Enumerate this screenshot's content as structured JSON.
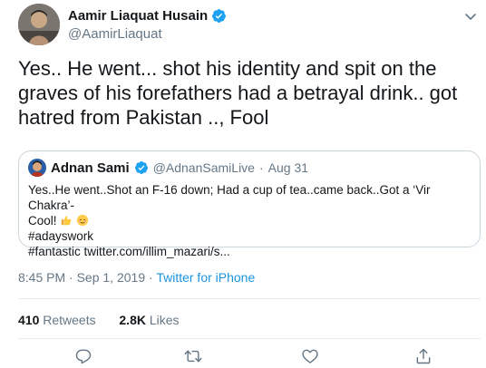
{
  "author": {
    "display_name": "Aamir Liaquat Husain",
    "handle": "@AamirLiaquat"
  },
  "tweet": {
    "text": "Yes.. He went... shot his identity and spit on the graves of his forefathers had a betrayal drink.. got hatred from Pakistan .., Fool"
  },
  "quoted_tweet": {
    "display_name": "Adnan Sami",
    "handle": "@AdnanSamiLive",
    "separator": "·",
    "date": "Aug 31",
    "line1": "Yes..He went..Shot an F-16 down; Had a cup of tea..came back..Got a ‘Vir Chakra’-",
    "line2": "Cool!",
    "hashtag": "#adayswork",
    "link_line": "#fantastic twitter.com/illim_mazari/s..."
  },
  "meta": {
    "time": "8:45 PM",
    "sep": "·",
    "date": "Sep 1, 2019",
    "sep2": "·",
    "source": "Twitter for iPhone"
  },
  "stats": {
    "retweets_count": "410",
    "retweets_label": "Retweets",
    "likes_count": "2.8K",
    "likes_label": "Likes"
  },
  "colors": {
    "accent": "#1da1f2",
    "secondary_text": "#657786",
    "border": "#ccd6dd"
  },
  "icons": [
    "verified-badge",
    "chevron-down-icon",
    "reply-icon",
    "retweet-icon",
    "like-icon",
    "share-icon",
    "thumbs-up-emoji",
    "relieved-face-emoji"
  ]
}
